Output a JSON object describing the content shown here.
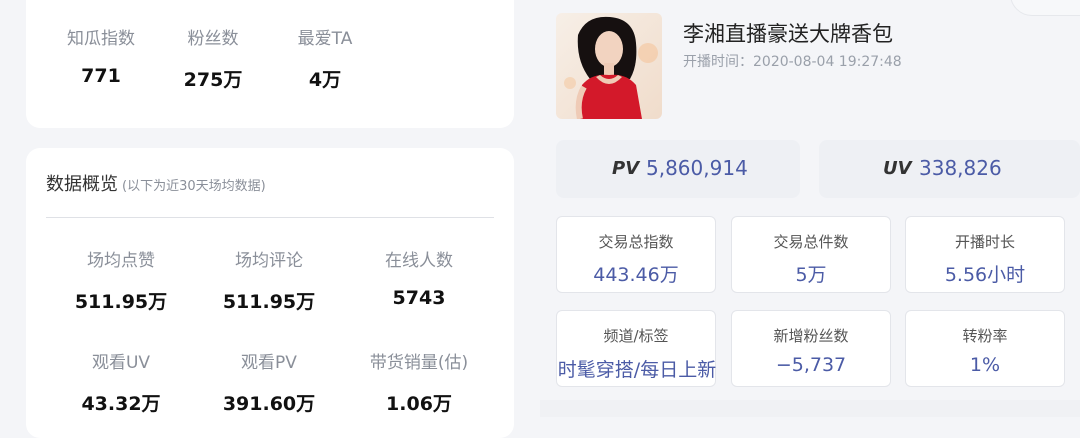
{
  "top_stats": [
    {
      "label": "知瓜指数",
      "value": "771"
    },
    {
      "label": "粉丝数",
      "value": "275万"
    },
    {
      "label": "最爱TA",
      "value": "4万"
    }
  ],
  "overview": {
    "title": "数据概览",
    "subtitle": "(以下为近30天场均数据)",
    "stats": [
      {
        "label": "场均点赞",
        "value": "511.95万"
      },
      {
        "label": "场均评论",
        "value": "511.95万"
      },
      {
        "label": "在线人数",
        "value": "5743"
      },
      {
        "label": "观看UV",
        "value": "43.32万"
      },
      {
        "label": "观看PV",
        "value": "391.60万"
      },
      {
        "label": "带货销量(估)",
        "value": "1.06万"
      }
    ]
  },
  "live": {
    "title": "李湘直播豪送大牌香包",
    "time": "开播时间：2020-08-04 19:27:48"
  },
  "pv": {
    "key": "PV",
    "value": "5,860,914"
  },
  "uv": {
    "key": "UV",
    "value": "338,826"
  },
  "cells": [
    {
      "label": "交易总指数",
      "value": "443.46万"
    },
    {
      "label": "交易总件数",
      "value": "5万"
    },
    {
      "label": "开播时长",
      "value": "5.56小时"
    },
    {
      "label": "频道/标签",
      "value": "时髦穿搭/每日上新"
    },
    {
      "label": "新增粉丝数",
      "value": "−5,737"
    },
    {
      "label": "转粉率",
      "value": "1%"
    }
  ],
  "colors": {
    "accent": "#4b5ba6",
    "background": "#f4f5f8",
    "card": "#ffffff",
    "metric_box": "#eef0f4"
  }
}
